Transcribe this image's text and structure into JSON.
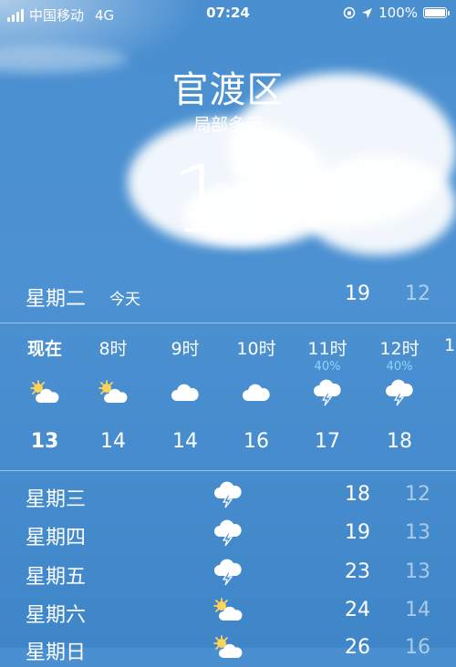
{
  "status_bar": {
    "carrier": "中国移动",
    "network": "4G",
    "time": "07:24",
    "battery": "100%",
    "battery_level": 1.0
  },
  "location": {
    "city": "官渡区",
    "condition": "局部多云",
    "current_temp": "13"
  },
  "today": {
    "day": "星期二",
    "tag": "今天",
    "high": "19",
    "low": "12"
  },
  "hourly": [
    {
      "label": "现在",
      "pop": "",
      "icon": "partly-sunny-icon",
      "temp": "13"
    },
    {
      "label": "8时",
      "pop": "",
      "icon": "partly-sunny-icon",
      "temp": "14"
    },
    {
      "label": "9时",
      "pop": "",
      "icon": "cloud-icon",
      "temp": "14"
    },
    {
      "label": "10时",
      "pop": "",
      "icon": "cloud-icon",
      "temp": "16"
    },
    {
      "label": "11时",
      "pop": "40%",
      "icon": "thunderstorm-icon",
      "temp": "17"
    },
    {
      "label": "12时",
      "pop": "40%",
      "icon": "thunderstorm-icon",
      "temp": "18"
    },
    {
      "label": "1",
      "pop": "",
      "icon": "",
      "temp": ""
    }
  ],
  "daily": [
    {
      "day": "星期三",
      "icon": "thunderstorm-icon",
      "high": "18",
      "low": "12"
    },
    {
      "day": "星期四",
      "icon": "thunderstorm-icon",
      "high": "19",
      "low": "13"
    },
    {
      "day": "星期五",
      "icon": "thunderstorm-icon",
      "high": "23",
      "low": "13"
    },
    {
      "day": "星期六",
      "icon": "partly-sunny-icon",
      "high": "24",
      "low": "14"
    },
    {
      "day": "星期日",
      "icon": "partly-sunny-icon",
      "high": "26",
      "low": "16"
    }
  ],
  "colors": {
    "background": "#4a8fd0",
    "precip": "#8fd3ff"
  }
}
